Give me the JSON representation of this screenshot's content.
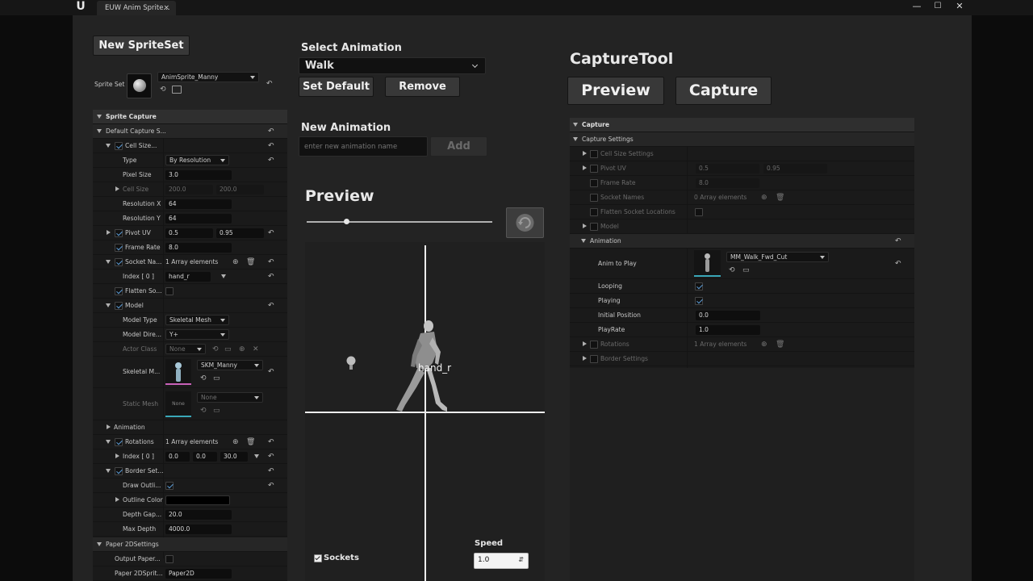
{
  "window": {
    "tab_title": "EUW Anim Sprite...",
    "tab_close": "×",
    "minimize": "—",
    "maximize": "☐",
    "close": "✕"
  },
  "left": {
    "new_spriteset_label": "New SpriteSet",
    "sprite_set_label": "Sprite Set",
    "sprite_set_value": "AnimSprite_Manny",
    "rows": {
      "sprite_capture": "Sprite Capture",
      "default_capture": "Default Capture S...",
      "cell_size": "Cell Size...",
      "type": "Type",
      "type_value": "By Resolution",
      "pixel_size": "Pixel Size",
      "pixel_size_value": "3.0",
      "cell_size2": "Cell Size",
      "cell_size_x": "200.0",
      "cell_size_y": "200.0",
      "resolution_x": "Resolution X",
      "resolution_x_value": "64",
      "resolution_y": "Resolution Y",
      "resolution_y_value": "64",
      "pivot_uv": "Pivot UV",
      "pivot_u": "0.5",
      "pivot_v": "0.95",
      "frame_rate": "Frame Rate",
      "frame_rate_value": "8.0",
      "socket_names": "Socket Na...",
      "socket_count": "1 Array elements",
      "index0": "Index [ 0 ]",
      "socket_value": "hand_r",
      "flatten": "Flatten So...",
      "model": "Model",
      "model_type": "Model Type",
      "model_type_value": "Skeletal Mesh",
      "model_dir": "Model Dire...",
      "model_dir_value": "Y+",
      "actor_class": "Actor Class",
      "actor_class_value": "None",
      "skeletal_mesh": "Skeletal M...",
      "skeletal_mesh_value": "SKM_Manny",
      "static_mesh": "Static Mesh",
      "static_mesh_value": "None",
      "static_thumb": "None",
      "animation": "Animation",
      "rotations": "Rotations",
      "rotations_count": "1 Array elements",
      "rot_index": "Index [ 0 ]",
      "rot_x": "0.0",
      "rot_y": "0.0",
      "rot_z": "30.0",
      "border_settings": "Border Set...",
      "draw_outline": "Draw Outli...",
      "outline_color": "Outline Color",
      "depth_gap": "Depth Gap...",
      "depth_gap_value": "20.0",
      "max_depth": "Max Depth",
      "max_depth_value": "4000.0",
      "paper2d_settings": "Paper 2DSettings",
      "output_paper": "Output Paper...",
      "paper2d_sprite": "Paper 2DSprit...",
      "paper2d_value": "Paper2D"
    }
  },
  "middle": {
    "select_animation_label": "Select Animation",
    "animation_value": "Walk",
    "set_default_label": "Set Default",
    "remove_label": "Remove",
    "new_animation_label": "New Animation",
    "new_animation_placeholder": "enter new animation name",
    "add_label": "Add",
    "preview_title": "Preview",
    "socket_overlay": "hand_r",
    "sockets_label": "Sockets",
    "speed_label": "Speed",
    "speed_value": "1.0"
  },
  "right": {
    "capture_tool_title": "CaptureTool",
    "preview_label": "Preview",
    "capture_label": "Capture",
    "rows": {
      "capture": "Capture",
      "capture_settings": "Capture Settings",
      "cell_size_settings": "Cell Size Settings",
      "pivot_uv": "Pivot UV",
      "pivot_u": "0.5",
      "pivot_v": "0.95",
      "frame_rate": "Frame Rate",
      "frame_rate_value": "8.0",
      "socket_names": "Socket Names",
      "socket_count": "0 Array elements",
      "flatten": "Flatten Socket Locations",
      "model": "Model",
      "animation": "Animation",
      "anim_to_play": "Anim to Play",
      "anim_value": "MM_Walk_Fwd_Cut",
      "looping": "Looping",
      "playing": "Playing",
      "initial_position": "Initial Position",
      "initial_position_value": "0.0",
      "play_rate": "PlayRate",
      "play_rate_value": "1.0",
      "rotations": "Rotations",
      "rotations_count": "1 Array elements",
      "border_settings": "Border Settings"
    }
  }
}
